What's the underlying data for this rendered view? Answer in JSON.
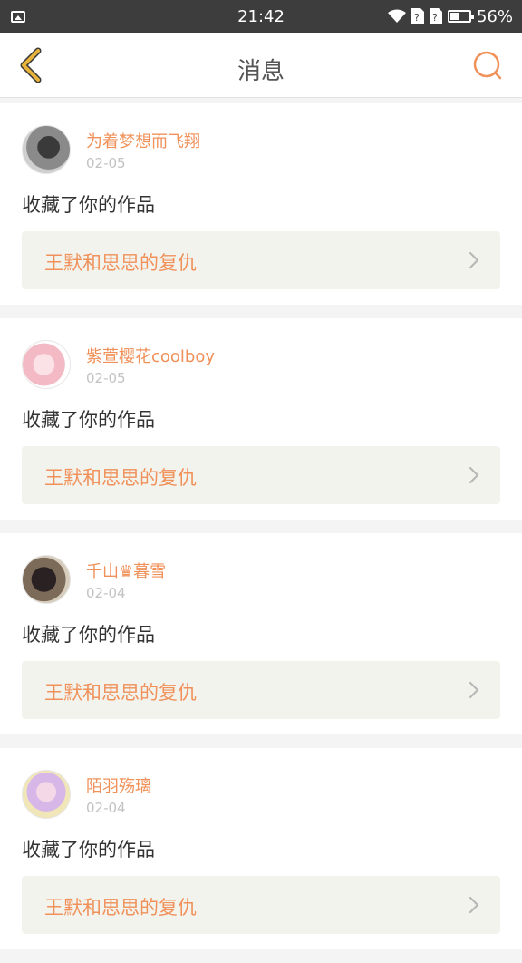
{
  "status_bar": {
    "time": "21:42",
    "battery": "56%",
    "battery_level": 0.56,
    "icons": [
      "image-notification-icon",
      "wifi-icon",
      "sim-no-signal-icon",
      "sim-no-signal-icon",
      "battery-icon"
    ]
  },
  "header": {
    "title": "消息",
    "back_icon": "chevron-left-icon",
    "search_icon": "search-icon",
    "accent_color": "#f0915a",
    "back_color": "#e8b33a"
  },
  "messages": [
    {
      "username": "为着梦想而飞翔",
      "date": "02-05",
      "action": "收藏了你的作品",
      "work_title": "王默和思思的复仇"
    },
    {
      "username": "紫萱樱花coolboy",
      "date": "02-05",
      "action": "收藏了你的作品",
      "work_title": "王默和思思的复仇"
    },
    {
      "username": "千山♛暮雪",
      "date": "02-04",
      "action": "收藏了你的作品",
      "work_title": "王默和思思的复仇"
    },
    {
      "username": "陌羽殇璃",
      "date": "02-04",
      "action": "收藏了你的作品",
      "work_title": "王默和思思的复仇"
    }
  ]
}
